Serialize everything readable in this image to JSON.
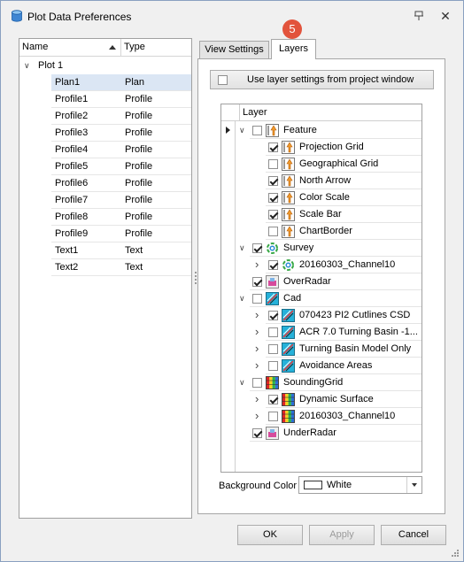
{
  "window": {
    "title": "Plot Data Preferences"
  },
  "left_tree": {
    "columns": {
      "name": "Name",
      "type": "Type"
    },
    "root": "Plot 1",
    "rows": [
      {
        "name": "Plan1",
        "type": "Plan",
        "selected": true
      },
      {
        "name": "Profile1",
        "type": "Profile"
      },
      {
        "name": "Profile2",
        "type": "Profile"
      },
      {
        "name": "Profile3",
        "type": "Profile"
      },
      {
        "name": "Profile4",
        "type": "Profile"
      },
      {
        "name": "Profile5",
        "type": "Profile"
      },
      {
        "name": "Profile6",
        "type": "Profile"
      },
      {
        "name": "Profile7",
        "type": "Profile"
      },
      {
        "name": "Profile8",
        "type": "Profile"
      },
      {
        "name": "Profile9",
        "type": "Profile"
      },
      {
        "name": "Text1",
        "type": "Text"
      },
      {
        "name": "Text2",
        "type": "Text"
      }
    ]
  },
  "tabs": {
    "view_settings": "View Settings",
    "layers": "Layers",
    "badge": "5"
  },
  "layers": {
    "use_project_settings": "Use layer settings from project window",
    "column_header": "Layer",
    "rows": [
      {
        "name": "Feature",
        "level": 0,
        "expander": "open",
        "checked": false,
        "icon": "feature-icon",
        "current": true
      },
      {
        "name": "Projection Grid",
        "level": 1,
        "expander": "none",
        "checked": true,
        "icon": "feature-icon"
      },
      {
        "name": "Geographical Grid",
        "level": 1,
        "expander": "none",
        "checked": false,
        "icon": "feature-icon"
      },
      {
        "name": "North Arrow",
        "level": 1,
        "expander": "none",
        "checked": true,
        "icon": "feature-icon"
      },
      {
        "name": "Color Scale",
        "level": 1,
        "expander": "none",
        "checked": true,
        "icon": "feature-icon"
      },
      {
        "name": "Scale Bar",
        "level": 1,
        "expander": "none",
        "checked": true,
        "icon": "feature-icon"
      },
      {
        "name": "ChartBorder",
        "level": 1,
        "expander": "none",
        "checked": false,
        "icon": "feature-icon"
      },
      {
        "name": "Survey",
        "level": 0,
        "expander": "open",
        "checked": true,
        "icon": "survey-icon"
      },
      {
        "name": "20160303_Channel10",
        "level": 1,
        "expander": "closed",
        "checked": true,
        "icon": "survey-icon"
      },
      {
        "name": "OverRadar",
        "level": 0,
        "expander": "none",
        "checked": true,
        "icon": "radar-icon"
      },
      {
        "name": "Cad",
        "level": 0,
        "expander": "open",
        "checked": false,
        "icon": "cad-icon"
      },
      {
        "name": "070423 PI2 Cutlines CSD",
        "level": 1,
        "expander": "closed",
        "checked": true,
        "icon": "cad-icon"
      },
      {
        "name": "ACR 7.0 Turning Basin -1...",
        "level": 1,
        "expander": "closed",
        "checked": false,
        "icon": "cad-icon"
      },
      {
        "name": "Turning Basin Model Only",
        "level": 1,
        "expander": "closed",
        "checked": false,
        "icon": "cad-icon"
      },
      {
        "name": "Avoidance Areas",
        "level": 1,
        "expander": "closed",
        "checked": false,
        "icon": "cad-icon"
      },
      {
        "name": "SoundingGrid",
        "level": 0,
        "expander": "open",
        "checked": false,
        "icon": "sounding-grid-icon"
      },
      {
        "name": "Dynamic Surface",
        "level": 1,
        "expander": "closed",
        "checked": true,
        "icon": "sounding-grid-icon"
      },
      {
        "name": "20160303_Channel10",
        "level": 1,
        "expander": "closed",
        "checked": false,
        "icon": "sounding-grid-icon"
      },
      {
        "name": "UnderRadar",
        "level": 0,
        "expander": "none",
        "checked": true,
        "icon": "radar-icon"
      }
    ],
    "background_color_label": "Background Color",
    "background_color_value": "White",
    "background_swatch": "#ffffff"
  },
  "buttons": {
    "ok": "OK",
    "apply": "Apply",
    "cancel": "Cancel"
  },
  "colors": {
    "selection": "#dbe6f4",
    "badge": "#e2533c",
    "border": "#a6a6a6"
  }
}
